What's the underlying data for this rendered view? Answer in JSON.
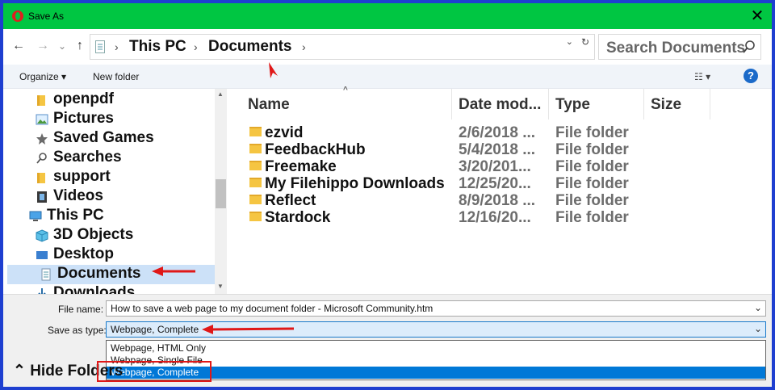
{
  "window": {
    "title": "Save As",
    "close_glyph": "✕",
    "app_icon": "opera-icon"
  },
  "nav": {
    "back": "←",
    "forward": "→",
    "recent": "⌄",
    "up": "↑",
    "breadcrumbs": [
      "This PC",
      "Documents"
    ],
    "separator": "›",
    "dropdown": "⌄",
    "refresh": "↻",
    "search_placeholder": "Search Documents"
  },
  "toolbar": {
    "organize": "Organize ▾",
    "new_folder": "New folder",
    "view": "☷ ▾",
    "help": "?"
  },
  "sidebar": {
    "items": [
      {
        "label": "openpdf",
        "icon": "folder-icon"
      },
      {
        "label": "Pictures",
        "icon": "pictures-icon"
      },
      {
        "label": "Saved Games",
        "icon": "saved-games-icon"
      },
      {
        "label": "Searches",
        "icon": "search-icon"
      },
      {
        "label": "support",
        "icon": "folder-icon"
      },
      {
        "label": "Videos",
        "icon": "videos-icon"
      },
      {
        "label": "This PC",
        "icon": "computer-icon"
      },
      {
        "label": "3D Objects",
        "icon": "cube-icon"
      },
      {
        "label": "Desktop",
        "icon": "desktop-icon"
      },
      {
        "label": "Documents",
        "icon": "documents-icon"
      },
      {
        "label": "Downloads",
        "icon": "downloads-icon"
      }
    ]
  },
  "files": {
    "columns": [
      "Name",
      "Date mod...",
      "Type",
      "Size"
    ],
    "sort_arrow": "^",
    "rows": [
      {
        "name": "ezvid",
        "date": "2/6/2018 ...",
        "type": "File folder"
      },
      {
        "name": "FeedbackHub",
        "date": "5/4/2018 ...",
        "type": "File folder"
      },
      {
        "name": "Freemake",
        "date": "3/20/201...",
        "type": "File folder"
      },
      {
        "name": "My Filehippo Downloads",
        "date": "12/25/20...",
        "type": "File folder"
      },
      {
        "name": "Reflect",
        "date": "8/9/2018 ...",
        "type": "File folder"
      },
      {
        "name": "Stardock",
        "date": "12/16/20...",
        "type": "File folder"
      }
    ]
  },
  "form": {
    "filename_label": "File name:",
    "filename_value": "How to save a web page to my document folder - Microsoft Community.htm",
    "savetype_label": "Save as type:",
    "savetype_value": "Webpage, Complete",
    "options": [
      "Webpage, HTML Only",
      "Webpage, Single File",
      "Webpage, Complete"
    ],
    "chevron": "⌄"
  },
  "footer": {
    "hide_folders": "⌃ Hide Folders"
  },
  "colors": {
    "titlebar": "#00c642",
    "frame": "#1e3fd0",
    "selection": "#0078d7",
    "annotation": "#e01818"
  }
}
